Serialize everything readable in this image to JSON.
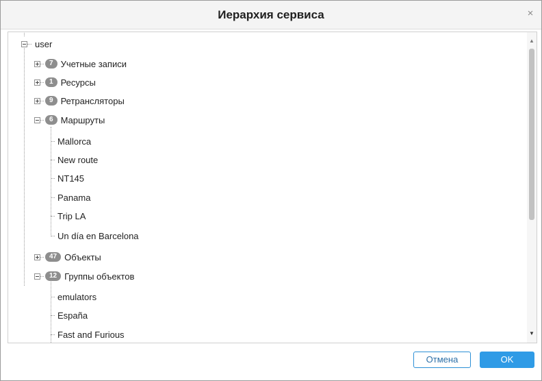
{
  "dialog": {
    "title": "Иерархия сервиса",
    "close_glyph": "×"
  },
  "tree": {
    "root_label": "user",
    "nodes": [
      {
        "count": "7",
        "label": "Учетные записи",
        "expanded": false
      },
      {
        "count": "1",
        "label": "Ресурсы",
        "expanded": false
      },
      {
        "count": "9",
        "label": "Ретрансляторы",
        "expanded": false
      },
      {
        "count": "6",
        "label": "Маршруты",
        "expanded": true,
        "children": [
          "Mallorca",
          "New route",
          "NT145",
          "Panama",
          "Trip LA",
          "Un día en Barcelona"
        ]
      },
      {
        "count": "47",
        "label": "Объекты",
        "expanded": false
      },
      {
        "count": "12",
        "label": "Группы объектов",
        "expanded": true,
        "children": [
          "emulators",
          "España",
          "Fast and Furious"
        ]
      }
    ]
  },
  "scrollbar": {
    "up_glyph": "▲",
    "down_glyph": "▼"
  },
  "buttons": {
    "cancel": "Отмена",
    "ok": "OK"
  },
  "colors": {
    "badge": "#8e8e8e",
    "accent": "#2f9be6"
  }
}
